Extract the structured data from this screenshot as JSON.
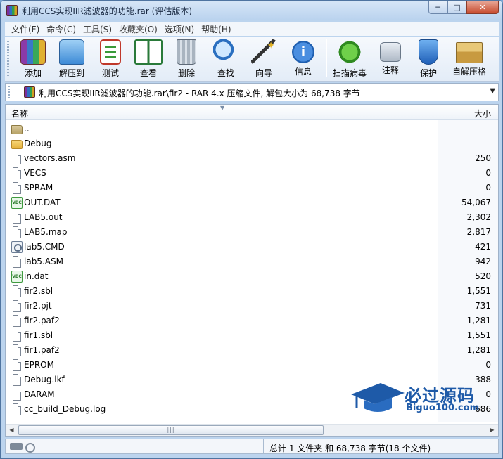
{
  "window": {
    "title": "利用CCS实现IIR滤波器的功能.rar (评估版本)",
    "min": "─",
    "max": "□",
    "close": "✕"
  },
  "menu": [
    "文件(F)",
    "命令(C)",
    "工具(S)",
    "收藏夹(O)",
    "选项(N)",
    "帮助(H)"
  ],
  "toolbar": [
    {
      "label": "添加",
      "icon": "add-archive-icon"
    },
    {
      "label": "解压到",
      "icon": "extract-to-icon"
    },
    {
      "label": "测试",
      "icon": "test-icon"
    },
    {
      "label": "查看",
      "icon": "view-icon"
    },
    {
      "label": "删除",
      "icon": "delete-icon"
    },
    {
      "label": "查找",
      "icon": "find-icon"
    },
    {
      "label": "向导",
      "icon": "wizard-icon"
    },
    {
      "label": "信息",
      "icon": "info-icon"
    },
    {
      "label": "扫描病毒",
      "icon": "virus-scan-icon"
    },
    {
      "label": "注释",
      "icon": "comment-icon"
    },
    {
      "label": "保护",
      "icon": "protect-icon"
    },
    {
      "label": "自解压格",
      "icon": "sfx-icon"
    }
  ],
  "address": {
    "path": "利用CCS实现IIR滤波器的功能.rar\\fir2 - RAR 4.x 压缩文件, 解包大小为 68,738 字节",
    "dropdown": "▼"
  },
  "columns": {
    "name": "名称",
    "size": "大小"
  },
  "files": [
    {
      "name": "..",
      "size": "",
      "type": "folder-up"
    },
    {
      "name": "Debug",
      "size": "",
      "type": "folder"
    },
    {
      "name": "vectors.asm",
      "size": "250",
      "type": "file"
    },
    {
      "name": "VECS",
      "size": "0",
      "type": "file"
    },
    {
      "name": "SPRAM",
      "size": "0",
      "type": "file"
    },
    {
      "name": "OUT.DAT",
      "size": "54,067",
      "type": "dat"
    },
    {
      "name": "LAB5.out",
      "size": "2,302",
      "type": "file"
    },
    {
      "name": "LAB5.map",
      "size": "2,817",
      "type": "file"
    },
    {
      "name": "lab5.CMD",
      "size": "421",
      "type": "cmd"
    },
    {
      "name": "lab5.ASM",
      "size": "942",
      "type": "file"
    },
    {
      "name": "in.dat",
      "size": "520",
      "type": "dat"
    },
    {
      "name": "fir2.sbl",
      "size": "1,551",
      "type": "file"
    },
    {
      "name": "fir2.pjt",
      "size": "731",
      "type": "file"
    },
    {
      "name": "fir2.paf2",
      "size": "1,281",
      "type": "file"
    },
    {
      "name": "fir1.sbl",
      "size": "1,551",
      "type": "file"
    },
    {
      "name": "fir1.paf2",
      "size": "1,281",
      "type": "file"
    },
    {
      "name": "EPROM",
      "size": "0",
      "type": "file"
    },
    {
      "name": "Debug.lkf",
      "size": "388",
      "type": "file"
    },
    {
      "name": "DARAM",
      "size": "0",
      "type": "file"
    },
    {
      "name": "cc_build_Debug.log",
      "size": "686",
      "type": "file"
    }
  ],
  "status": {
    "summary": "总计 1 文件夹 和 68,738 字节(18 个文件)"
  },
  "watermark": {
    "title": "必过源码",
    "subtitle": "Biguo100.com"
  }
}
